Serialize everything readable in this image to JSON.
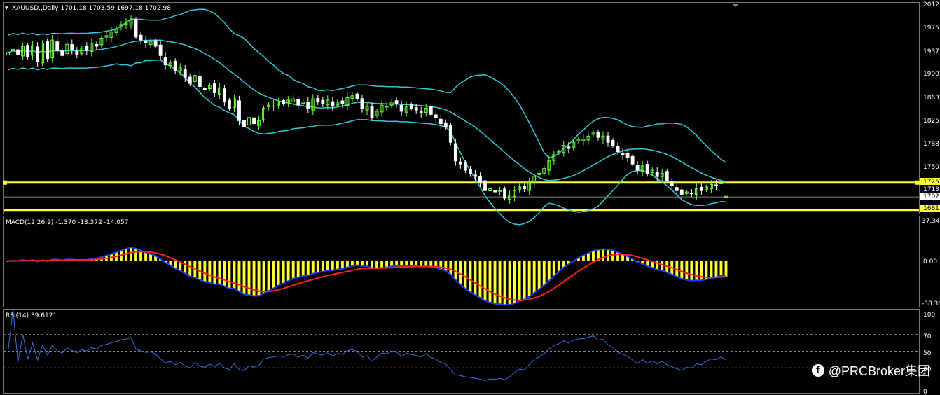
{
  "colors": {
    "background": "#000000",
    "bull": "#6CFF3A",
    "bear": "#FFFFFF",
    "bands": "#33C8D6",
    "hline": "#FFFF33",
    "macd_hist": "#FFFF33",
    "macd_line": "#1F3BFF",
    "signal_line": "#FF2020",
    "rsi_line": "#3A6FE0",
    "grid": "#888888"
  },
  "main_panel": {
    "header": "XAUUSD.,Daily  1701.18 1703.59 1697.18 1702.98",
    "scale_labels": [
      "2012",
      "1975",
      "1937",
      "1900",
      "1863",
      "1825",
      "1788",
      "1750",
      "1713"
    ],
    "price_tags": [
      "1725.",
      "1702.",
      "1681."
    ]
  },
  "macd_panel": {
    "header": "MACD(12,26,9) -1.370 -13.372 -14.057",
    "scale_labels": [
      "37.34",
      "0.00",
      "-38.36"
    ]
  },
  "rsi_panel": {
    "header": "RSI(14) 39.6121",
    "scale_labels": [
      "100",
      "70",
      "50",
      "30",
      "0"
    ]
  },
  "watermark": {
    "icon": "facebook-icon",
    "text": "@PRCBroker集团"
  },
  "chart_data": [
    {
      "type": "candlestick",
      "title": "XAUUSD.,Daily",
      "ohlc_last": {
        "open": 1701.18,
        "high": 1703.59,
        "low": 1697.18,
        "close": 1702.98
      },
      "ylim": [
        1675,
        2015
      ],
      "yticks": [
        2012,
        1975,
        1937,
        1900,
        1863,
        1825,
        1788,
        1750,
        1713
      ],
      "horizontal_lines": [
        1725,
        1681
      ],
      "current_price": 1702,
      "close": [
        1935,
        1940,
        1932,
        1945,
        1928,
        1946,
        1920,
        1950,
        1925,
        1955,
        1938,
        1930,
        1948,
        1940,
        1932,
        1942,
        1938,
        1950,
        1945,
        1958,
        1962,
        1968,
        1973,
        1980,
        1982,
        1988,
        1960,
        1955,
        1950,
        1952,
        1945,
        1930,
        1915,
        1918,
        1905,
        1910,
        1895,
        1885,
        1898,
        1880,
        1875,
        1882,
        1870,
        1878,
        1855,
        1845,
        1860,
        1825,
        1815,
        1830,
        1820,
        1825,
        1845,
        1850,
        1852,
        1855,
        1852,
        1858,
        1860,
        1850,
        1855,
        1845,
        1860,
        1855,
        1852,
        1858,
        1848,
        1855,
        1852,
        1862,
        1865,
        1860,
        1845,
        1848,
        1830,
        1840,
        1850,
        1848,
        1855,
        1852,
        1840,
        1848,
        1845,
        1842,
        1838,
        1845,
        1835,
        1830,
        1820,
        1815,
        1790,
        1760,
        1755,
        1745,
        1740,
        1735,
        1725,
        1712,
        1715,
        1710,
        1712,
        1700,
        1705,
        1712,
        1718,
        1715,
        1725,
        1735,
        1740,
        1748,
        1760,
        1770,
        1775,
        1785,
        1780,
        1790,
        1795,
        1795,
        1800,
        1805,
        1798,
        1800,
        1790,
        1785,
        1775,
        1770,
        1765,
        1755,
        1745,
        1752,
        1740,
        1745,
        1735,
        1740,
        1728,
        1720,
        1712,
        1705,
        1710,
        1708,
        1715,
        1712,
        1718,
        1722,
        1720,
        1725,
        1702
      ],
      "bollinger": {
        "period": 20,
        "deviation": 2
      },
      "ohlc_note": ""
    },
    {
      "type": "bar",
      "title": "MACD(12,26,9)",
      "values_header": [
        -1.37,
        -13.372,
        -14.057
      ],
      "ylim": [
        -38.36,
        37.34
      ],
      "yticks": [
        37.34,
        0.0,
        -38.36
      ]
    },
    {
      "type": "line",
      "title": "RSI(14)",
      "last_value": 39.6121,
      "ylim": [
        0,
        100
      ],
      "levels": [
        70,
        50,
        30
      ],
      "yticks": [
        100,
        70,
        50,
        30,
        0
      ]
    }
  ]
}
